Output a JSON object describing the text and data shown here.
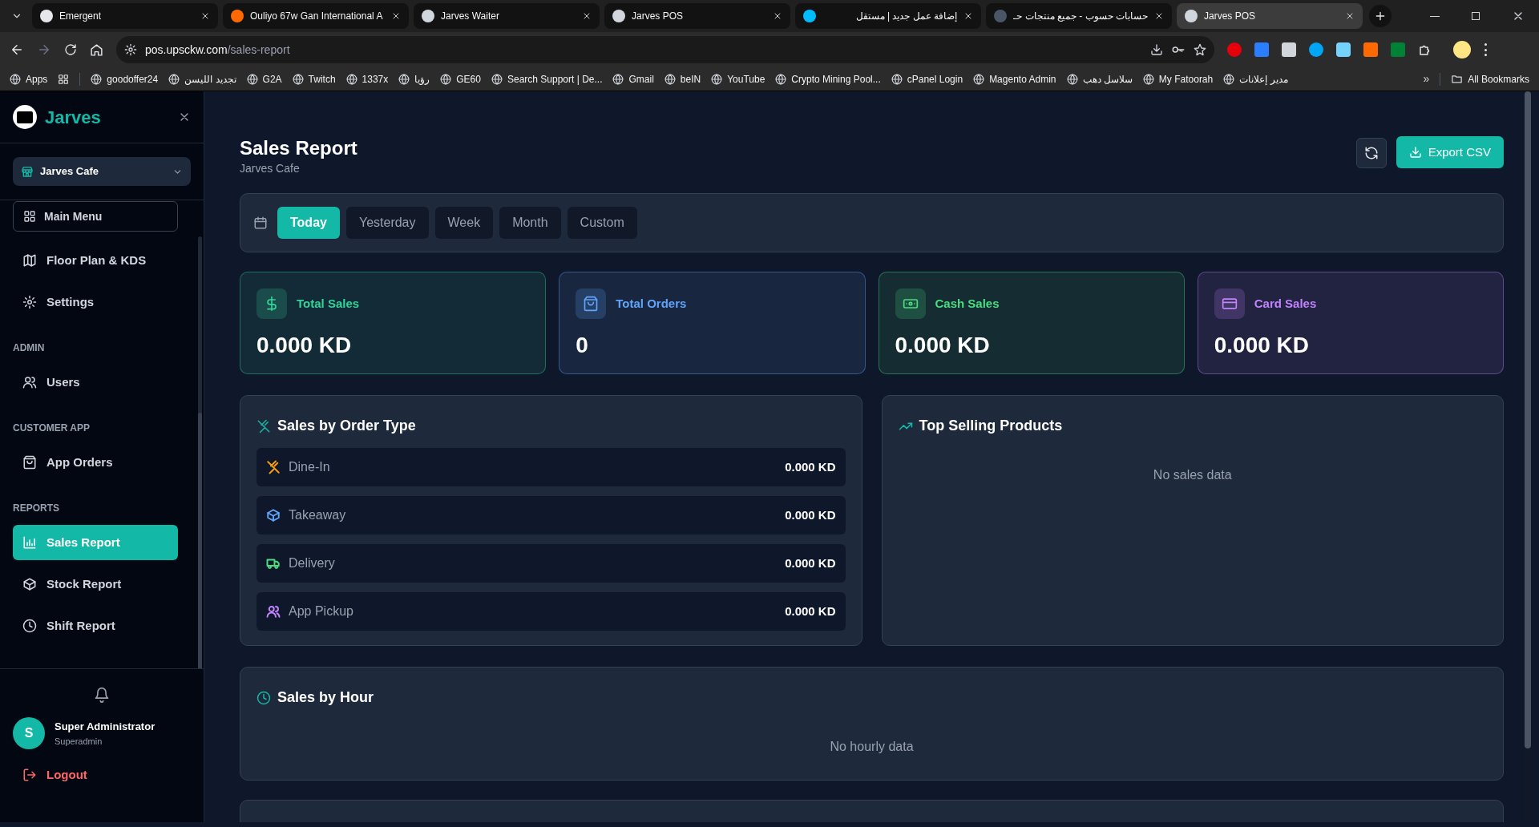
{
  "browser": {
    "tabs": [
      {
        "title": "Emergent",
        "selected": false
      },
      {
        "title": "Ouliyo 67w Gan International A",
        "selected": false
      },
      {
        "title": "Jarves Waiter",
        "selected": false
      },
      {
        "title": "Jarves POS",
        "selected": false
      },
      {
        "title": "إضافة عمل جديد | مستقل",
        "selected": false
      },
      {
        "title": "حسابات حسوب - جميع منتجات حـ",
        "selected": false
      },
      {
        "title": "Jarves POS",
        "selected": true
      }
    ],
    "url": {
      "host": "pos.upsckw.com",
      "path": "/sales-report"
    },
    "bookmarks": [
      {
        "label": "Apps"
      },
      {
        "label": "goodoffer24"
      },
      {
        "label": "تجديد الليسن"
      },
      {
        "label": "G2A"
      },
      {
        "label": "Twitch"
      },
      {
        "label": "1337x"
      },
      {
        "label": "رؤيا"
      },
      {
        "label": "GE60"
      },
      {
        "label": "Search Support | De..."
      },
      {
        "label": "Gmail"
      },
      {
        "label": "beIN"
      },
      {
        "label": "YouTube"
      },
      {
        "label": "Crypto Mining Pool..."
      },
      {
        "label": "cPanel Login"
      },
      {
        "label": "Magento Admin"
      },
      {
        "label": "سلاسل دهب"
      },
      {
        "label": "My Fatoorah"
      },
      {
        "label": "مدير إعلانات"
      }
    ],
    "more_bookmarks": "»",
    "all_bookmarks": "All Bookmarks"
  },
  "sidebar": {
    "brand": "Jarves",
    "branch": "Jarves Cafe",
    "main_menu": "Main Menu",
    "items": [
      {
        "kind": "link",
        "label": "Floor Plan & KDS",
        "selected": false
      },
      {
        "kind": "link",
        "label": "Settings",
        "selected": false
      },
      {
        "kind": "section",
        "label": "ADMIN"
      },
      {
        "kind": "link",
        "label": "Users",
        "selected": false
      },
      {
        "kind": "section",
        "label": "CUSTOMER APP"
      },
      {
        "kind": "link",
        "label": "App Orders",
        "selected": false
      },
      {
        "kind": "section",
        "label": "REPORTS"
      },
      {
        "kind": "link",
        "label": "Sales Report",
        "selected": true
      },
      {
        "kind": "link",
        "label": "Stock Report",
        "selected": false
      },
      {
        "kind": "link",
        "label": "Shift Report",
        "selected": false
      }
    ],
    "user": {
      "initial": "S",
      "name": "Super Administrator",
      "role": "Superadmin"
    },
    "logout": "Logout"
  },
  "page": {
    "title": "Sales Report",
    "subtitle": "Jarves Cafe",
    "export": "Export CSV",
    "filters": [
      {
        "label": "Today",
        "selected": true
      },
      {
        "label": "Yesterday",
        "selected": false
      },
      {
        "label": "Week",
        "selected": false
      },
      {
        "label": "Month",
        "selected": false
      },
      {
        "label": "Custom",
        "selected": false
      }
    ],
    "stats": [
      {
        "label": "Total Sales",
        "value": "0.000 KD",
        "color": "#34d399"
      },
      {
        "label": "Total Orders",
        "value": "0",
        "color": "#60a5fa"
      },
      {
        "label": "Cash Sales",
        "value": "0.000 KD",
        "color": "#4ade80"
      },
      {
        "label": "Card Sales",
        "value": "0.000 KD",
        "color": "#c084fc"
      }
    ],
    "order_type": {
      "title": "Sales by Order Type",
      "rows": [
        {
          "label": "Dine-In",
          "value": "0.000 KD",
          "color": "#f59e0b"
        },
        {
          "label": "Takeaway",
          "value": "0.000 KD",
          "color": "#60a5fa"
        },
        {
          "label": "Delivery",
          "value": "0.000 KD",
          "color": "#4ade80"
        },
        {
          "label": "App Pickup",
          "value": "0.000 KD",
          "color": "#c084fc"
        }
      ]
    },
    "top_selling": {
      "title": "Top Selling Products",
      "empty": "No sales data"
    },
    "hourly": {
      "title": "Sales by Hour",
      "empty": "No hourly data"
    }
  }
}
